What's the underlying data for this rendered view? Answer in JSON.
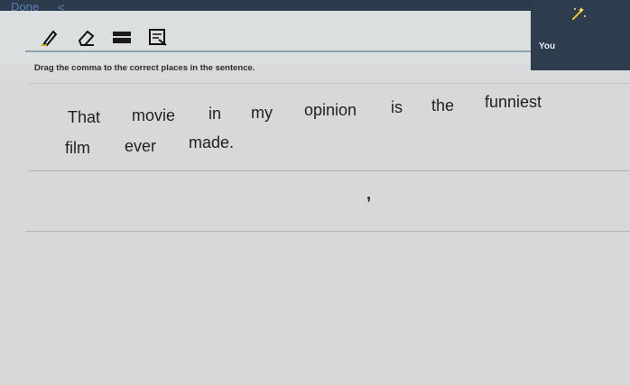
{
  "topbar": {
    "done_label": "Done",
    "back_glyph": "<"
  },
  "right_panel": {
    "user_label": "You",
    "icon": "sparkle-icon"
  },
  "toolbar": {
    "tools": [
      "pencil-icon",
      "eraser-icon",
      "keyboard-icon",
      "notes-icon"
    ]
  },
  "instruction": "Drag the comma to the correct places in the sentence.",
  "sentence": {
    "words": [
      "That",
      "movie",
      "in",
      "my",
      "opinion",
      "is",
      "the",
      "funniest",
      "film",
      "ever",
      "made."
    ]
  },
  "draggable": {
    "comma": ","
  },
  "colors": {
    "topbar": "#2c3b4d",
    "panel": "#2e3d4e",
    "link": "#5a7fae",
    "background": "#d8dadb"
  }
}
